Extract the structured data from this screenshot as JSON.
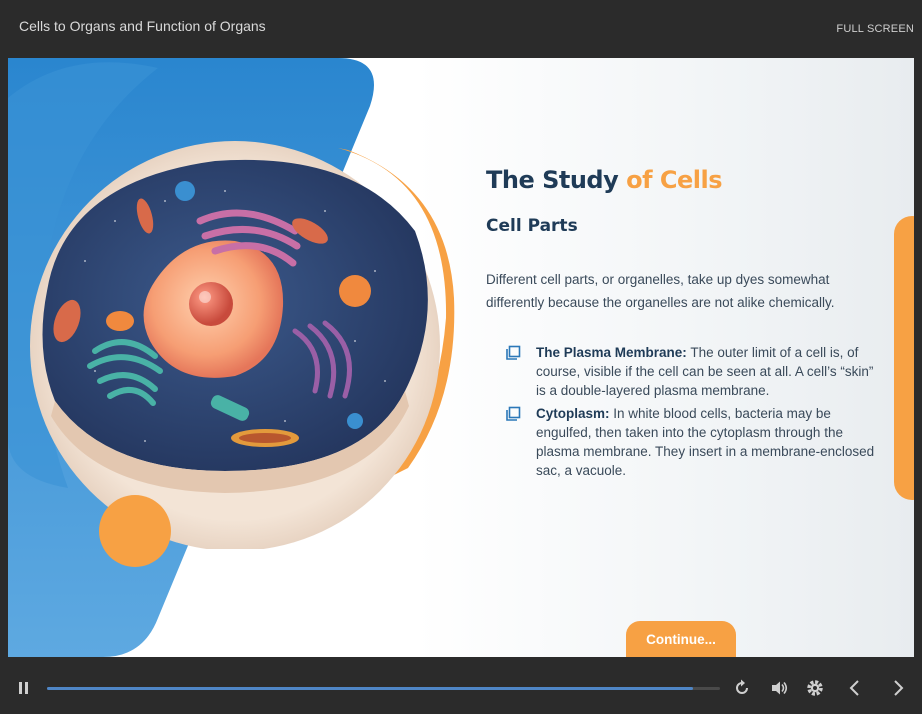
{
  "header": {
    "course_title": "Cells to Organs and Function of Organs",
    "fullscreen_label": "FULL SCREEN"
  },
  "slide": {
    "title_main": "The Study ",
    "title_accent": "of Cells",
    "subtitle": "Cell Parts",
    "intro": "Different cell parts, or organelles, take up dyes somewhat differently because the organelles are not alike chemically.",
    "bullets": [
      {
        "term": "The Plasma Membrane:",
        "text": " The outer limit of a cell is, of course, visible if the cell can be seen at all. A cell’s “skin” is a double-layered plasma membrane.",
        "icon": "copy-icon"
      },
      {
        "term": "Cytoplasm:",
        "text": " In white blood cells, bacteria may be engulfed, then taken into the cytoplasm through the plasma membrane. They insert in a membrane-enclosed sac, a vacuole.",
        "icon": "copy-icon"
      }
    ],
    "continue_label": "Continue..."
  },
  "player": {
    "progress": 0.96,
    "icons": [
      "pause-icon",
      "replay-icon",
      "volume-icon",
      "settings-icon",
      "prev-icon",
      "next-icon"
    ]
  },
  "colors": {
    "accent": "#f7a144",
    "heading": "#1f3b57",
    "blue": "#2b86cf",
    "bar_bg": "#2b2b2b"
  }
}
